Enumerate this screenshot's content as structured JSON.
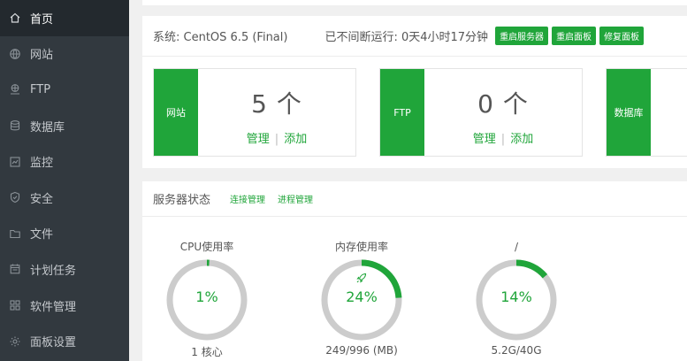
{
  "sidebar": {
    "items": [
      {
        "label": "首页",
        "icon": "home-icon",
        "active": true
      },
      {
        "label": "网站",
        "icon": "globe-icon"
      },
      {
        "label": "FTP",
        "icon": "ftp-icon"
      },
      {
        "label": "数据库",
        "icon": "database-icon"
      },
      {
        "label": "监控",
        "icon": "monitor-icon"
      },
      {
        "label": "安全",
        "icon": "shield-icon"
      },
      {
        "label": "文件",
        "icon": "folder-icon"
      },
      {
        "label": "计划任务",
        "icon": "calendar-icon"
      },
      {
        "label": "软件管理",
        "icon": "apps-icon"
      },
      {
        "label": "面板设置",
        "icon": "gear-icon"
      }
    ]
  },
  "system": {
    "os": "系统: CentOS 6.5 (Final)",
    "uptime": "已不间断运行: 0天4小时17分钟",
    "buttons": [
      "重启服务器",
      "重启面板",
      "修复面板"
    ]
  },
  "cards": [
    {
      "label": "网站",
      "count": "5 个",
      "manage": "管理",
      "add": "添加"
    },
    {
      "label": "FTP",
      "count": "0 个",
      "manage": "管理",
      "add": "添加"
    },
    {
      "label": "数据库"
    }
  ],
  "status": {
    "title": "服务器状态",
    "links": [
      "连接管理",
      "进程管理"
    ],
    "gauges": [
      {
        "label": "CPU使用率",
        "value": "1%",
        "percent": 1,
        "sub": "1 核心"
      },
      {
        "label": "内存使用率",
        "value": "24%",
        "percent": 24,
        "sub": "249/996 (MB)",
        "icon": "rocket-icon"
      },
      {
        "label": "/",
        "value": "14%",
        "percent": 14,
        "sub": "5.2G/40G"
      }
    ]
  },
  "colors": {
    "accent": "#20a53a",
    "sidebar": "#32393f",
    "ring_track": "#cccccc"
  }
}
